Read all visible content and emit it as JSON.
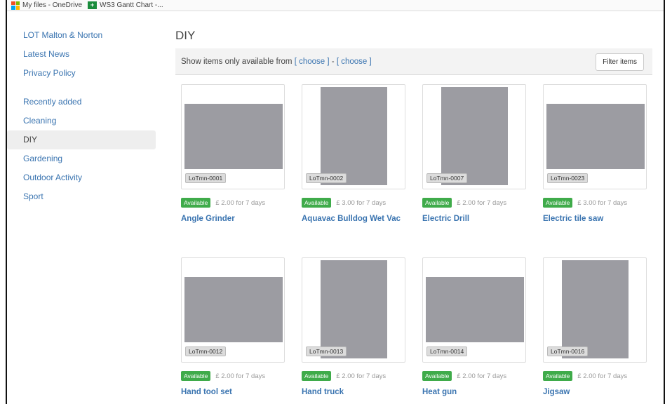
{
  "bookmarks": [
    {
      "icon": "microsoft-icon",
      "label": "My files - OneDrive"
    },
    {
      "icon": "gantt-icon",
      "label": "WS3 Gantt Chart -..."
    }
  ],
  "sidebar": {
    "groups": [
      {
        "items": [
          {
            "label": "LOT Malton & Norton"
          },
          {
            "label": "Latest News"
          },
          {
            "label": "Privacy Policy"
          }
        ]
      },
      {
        "items": [
          {
            "label": "Recently added"
          },
          {
            "label": "Cleaning"
          },
          {
            "label": "DIY",
            "active": true
          },
          {
            "label": "Gardening"
          },
          {
            "label": "Outdoor Activity"
          },
          {
            "label": "Sport"
          }
        ]
      }
    ]
  },
  "main": {
    "title": "DIY",
    "filter": {
      "text": "Show items only available from",
      "from_choose": "[ choose ]",
      "separator": "-",
      "to_choose": "[ choose ]",
      "button": "Filter items"
    },
    "items": [
      {
        "code": "LoTmn-0001",
        "status": "Available",
        "price": "£ 2.00 for 7 days",
        "title": "Angle Grinder",
        "photo": "angle-grinder-photo",
        "shape": "wide"
      },
      {
        "code": "LoTmn-0002",
        "status": "Available",
        "price": "£ 3.00 for 7 days",
        "title": "Aquavac Bulldog Wet Vac",
        "photo": "wet-vac-photo",
        "shape": "tall"
      },
      {
        "code": "LoTmn-0007",
        "status": "Available",
        "price": "£ 2.00 for 7 days",
        "title": "Electric Drill",
        "photo": "electric-drill-photo",
        "shape": "tall"
      },
      {
        "code": "LoTmn-0023",
        "status": "Available",
        "price": "£ 3.00 for 7 days",
        "title": "Electric tile saw",
        "photo": "tile-saw-photo",
        "shape": "wide"
      },
      {
        "code": "LoTmn-0012",
        "status": "Available",
        "price": "£ 2.00 for 7 days",
        "title": "Hand tool set",
        "photo": "hand-tool-set-photo",
        "shape": "wide"
      },
      {
        "code": "LoTmn-0013",
        "status": "Available",
        "price": "£ 2.00 for 7 days",
        "title": "Hand truck",
        "photo": "hand-truck-photo",
        "shape": "tall"
      },
      {
        "code": "LoTmn-0014",
        "status": "Available",
        "price": "£ 2.00 for 7 days",
        "title": "Heat gun",
        "photo": "heat-gun-photo",
        "shape": "wide"
      },
      {
        "code": "LoTmn-0016",
        "status": "Available",
        "price": "£ 2.00 for 7 days",
        "title": "Jigsaw",
        "photo": "jigsaw-photo",
        "shape": "tall"
      }
    ]
  },
  "colors": {
    "link": "#3a74b0",
    "available_badge": "#3fab4a",
    "active_nav_bg": "#eeeeee",
    "photo_bg": "#9c9ca2"
  }
}
